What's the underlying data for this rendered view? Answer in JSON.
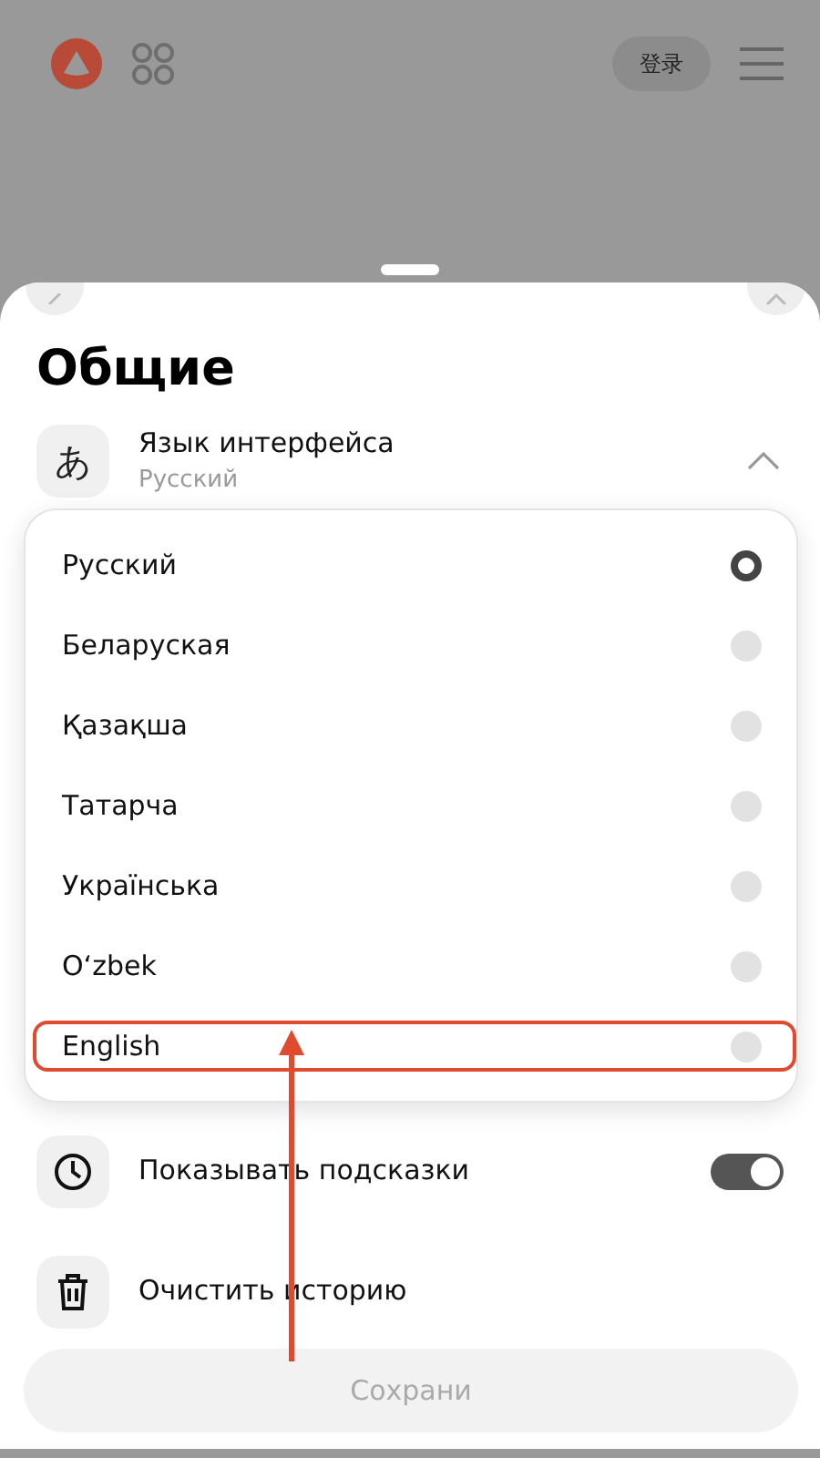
{
  "header": {
    "login_button": "登录"
  },
  "sheet": {
    "title": "Общие",
    "language_setting": {
      "glyph": "あ",
      "label": "Язык интерфейса",
      "value": "Русский",
      "expanded": true
    },
    "languages": [
      {
        "label": "Русский",
        "selected": true,
        "highlighted": false
      },
      {
        "label": "Беларуская",
        "selected": false,
        "highlighted": false
      },
      {
        "label": "Қазақша",
        "selected": false,
        "highlighted": false
      },
      {
        "label": "Татарча",
        "selected": false,
        "highlighted": false
      },
      {
        "label": "Українська",
        "selected": false,
        "highlighted": false
      },
      {
        "label": "O‘zbek",
        "selected": false,
        "highlighted": false
      },
      {
        "label": "English",
        "selected": false,
        "highlighted": true
      }
    ],
    "settings": [
      {
        "kind": "toggle",
        "label": "Показывать подсказки",
        "on": true
      },
      {
        "kind": "action",
        "label": "Очистить историю"
      }
    ],
    "save_button": "Сохрани"
  }
}
